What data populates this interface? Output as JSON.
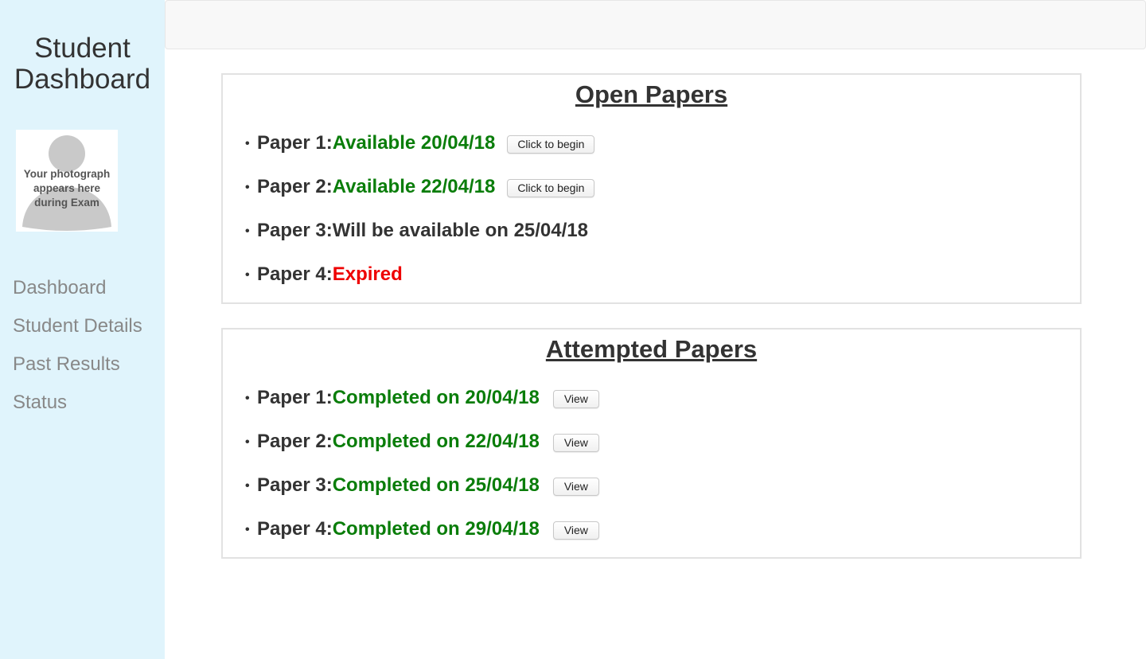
{
  "sidebar": {
    "brand_line1": "Student",
    "brand_line2": "Dashboard",
    "photo_icon": "user-silhouette-icon",
    "photo_text_line1": "Your photograph",
    "photo_text_line2": "appears here",
    "photo_text_line3": "during Exam",
    "nav": [
      {
        "label": "Dashboard"
      },
      {
        "label": "Student Details"
      },
      {
        "label": "Past Results"
      },
      {
        "label": "Status"
      }
    ]
  },
  "colors": {
    "sidebar_bg": "#e0f4fc",
    "available": "#0a7d0a",
    "expired": "#ee0000",
    "text": "#333333",
    "nav_text": "#888888"
  },
  "open_papers": {
    "title": "Open Papers",
    "items": [
      {
        "label": "Paper 1:",
        "status": "Available 20/04/18",
        "button": "Click to begin"
      },
      {
        "label": "Paper 2:",
        "status": "Available 22/04/18",
        "button": "Click to begin"
      },
      {
        "label": "Paper 3:",
        "status": "Will be available on 25/04/18"
      },
      {
        "label": "Paper 4:",
        "status": "Expired"
      }
    ]
  },
  "attempted_papers": {
    "title": "Attempted Papers",
    "items": [
      {
        "label": "Paper 1:",
        "status": "Completed on 20/04/18",
        "button": "View"
      },
      {
        "label": "Paper 2:",
        "status": "Completed on 22/04/18",
        "button": "View"
      },
      {
        "label": "Paper 3:",
        "status": "Completed on 25/04/18",
        "button": "View"
      },
      {
        "label": "Paper 4:",
        "status": "Completed on 29/04/18",
        "button": "View"
      }
    ]
  }
}
